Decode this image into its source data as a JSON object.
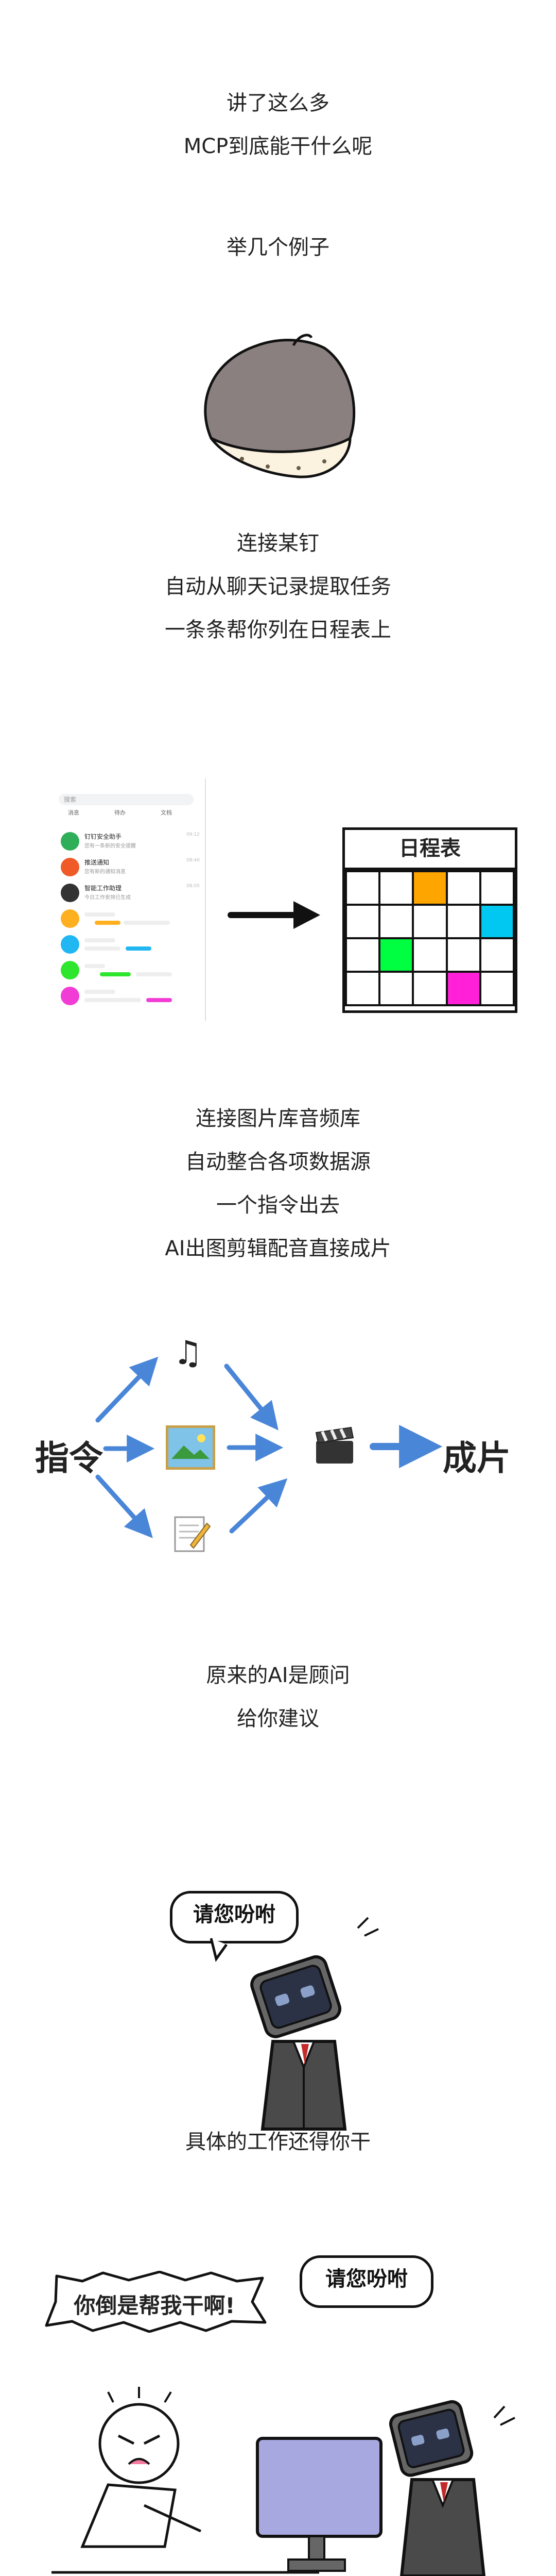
{
  "section1": {
    "line1": "讲了这么多",
    "line2": "MCP到底能干什么呢"
  },
  "section2": {
    "line1": "举几个例子"
  },
  "section3": {
    "line1": "连接某钉",
    "line2": "自动从聊天记录提取任务",
    "line3": "一条条帮你列在日程表上"
  },
  "chat": {
    "search": "搜索",
    "tabs": [
      "消息",
      "待办",
      "文档"
    ],
    "rows": [
      {
        "name": "钉钉安全助手",
        "preview": "您有一条新的安全提醒",
        "time": "09:12",
        "color": "#2fae5a"
      },
      {
        "name": "推送通知",
        "preview": "您有新的通知消息",
        "time": "08:40",
        "color": "#f05a28"
      },
      {
        "name": "智能工作助理",
        "preview": "今日工作安排已生成",
        "time": "08:05",
        "color": "#333333"
      },
      {
        "name": "",
        "preview": "",
        "time": "",
        "color": "#ffb020"
      },
      {
        "name": "",
        "preview": "",
        "time": "",
        "color": "#20b7f2"
      },
      {
        "name": "",
        "preview": "",
        "time": "",
        "color": "#2ee62e"
      },
      {
        "name": "",
        "preview": "",
        "time": "",
        "color": "#f23cd6"
      }
    ]
  },
  "schedule": {
    "title": "日程表",
    "colors": {
      "orange": "#ffa500",
      "cyan": "#00c8f0",
      "green": "#00ff40",
      "magenta": "#ff20d8"
    }
  },
  "section4": {
    "line1": "连接图片库音频库",
    "line2": "自动整合各项数据源",
    "line3": "一个指令出去",
    "line4": "AI出图剪辑配音直接成片"
  },
  "flow": {
    "source": "指令",
    "result": "成片",
    "arrow_color": "#4a86d8",
    "icons": [
      "music-note-icon",
      "picture-icon",
      "notepad-icon",
      "clapper-icon"
    ]
  },
  "section5": {
    "line1": "原来的AI是顾问",
    "line2": "给你建议"
  },
  "comic1": {
    "bubble": "请您吩咐"
  },
  "section6": {
    "line1": "具体的工作还得你干"
  },
  "comic2": {
    "shout": "你倒是帮我干啊!",
    "bubble": "请您吩咐"
  }
}
